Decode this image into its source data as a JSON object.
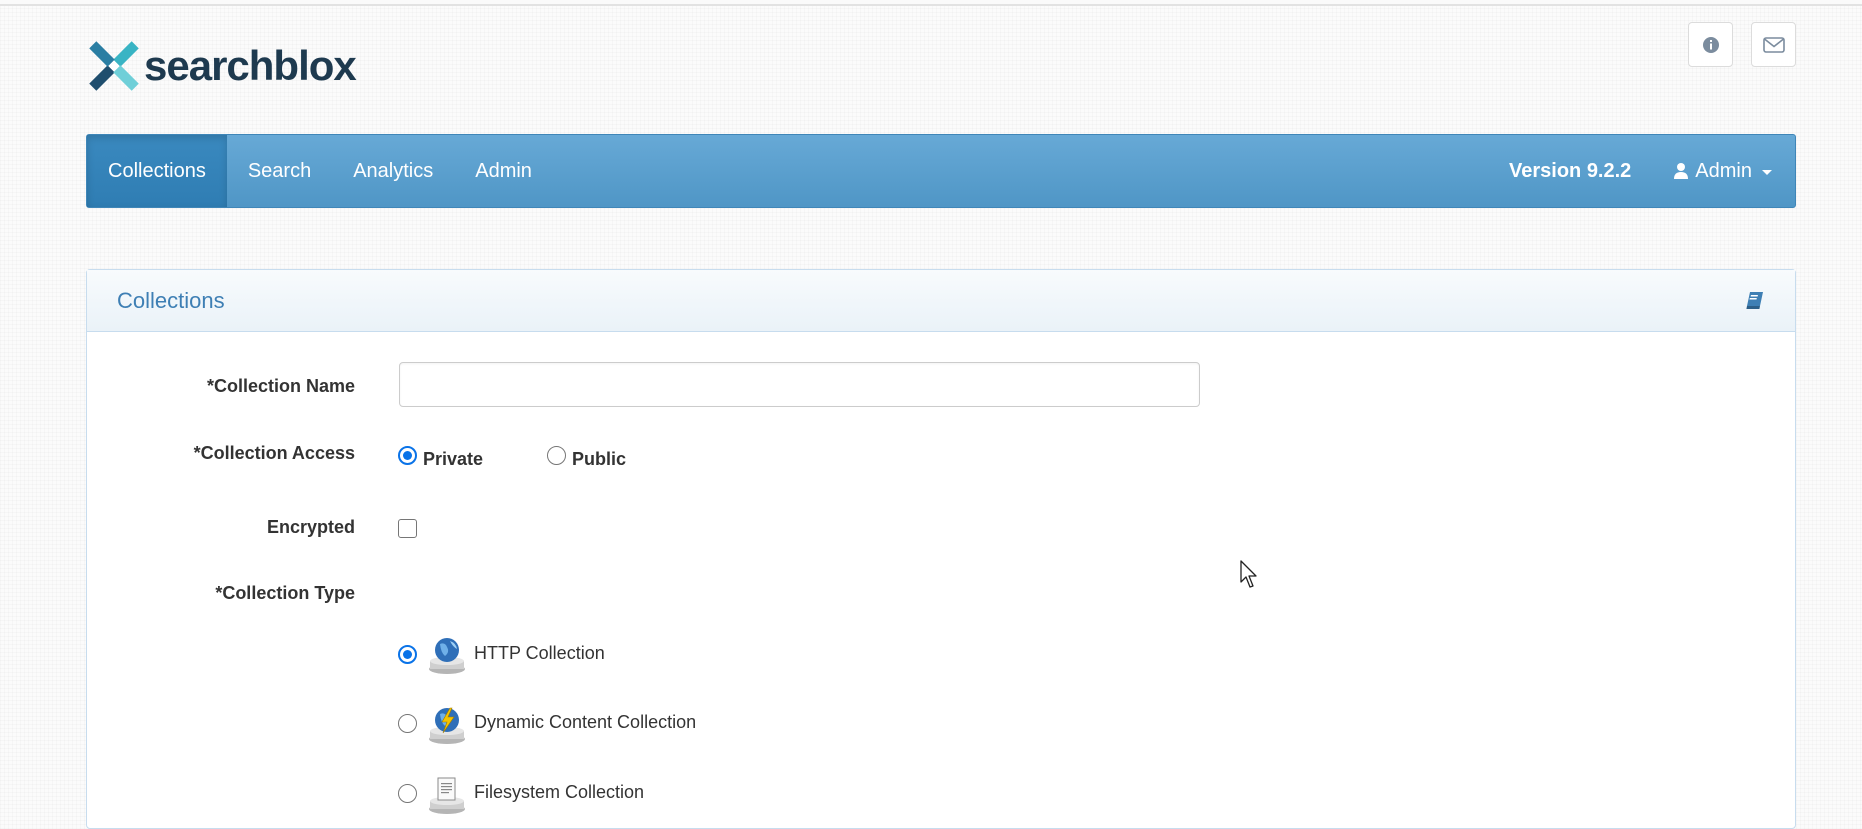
{
  "brand": {
    "name": "searchblox"
  },
  "header_buttons": [
    {
      "icon": "info-circle-icon"
    },
    {
      "icon": "envelope-icon"
    }
  ],
  "navbar": {
    "items": [
      {
        "label": "Collections",
        "active": true
      },
      {
        "label": "Search",
        "active": false
      },
      {
        "label": "Analytics",
        "active": false
      },
      {
        "label": "Admin",
        "active": false
      }
    ],
    "version": "Version 9.2.2",
    "user_label": "Admin"
  },
  "panel": {
    "title": "Collections",
    "help_icon": "book-icon"
  },
  "form": {
    "collection_name": {
      "label": "*Collection Name",
      "value": "",
      "placeholder": ""
    },
    "collection_access": {
      "label": "*Collection Access",
      "options": [
        "Private",
        "Public"
      ],
      "selected": "Private"
    },
    "encrypted": {
      "label": "Encrypted",
      "checked": false
    },
    "collection_type": {
      "label": "*Collection Type",
      "options": [
        {
          "label": "HTTP Collection",
          "icon": "globe-icon",
          "selected": true
        },
        {
          "label": "Dynamic Content Collection",
          "icon": "lightning-globe-icon",
          "selected": false
        },
        {
          "label": "Filesystem Collection",
          "icon": "document-icon",
          "selected": false
        }
      ]
    }
  },
  "colors": {
    "navbar": "#5aa0d0",
    "accent": "#0a73e8",
    "panel_title": "#3e7fb4",
    "logo_text": "#1e3a4f"
  }
}
